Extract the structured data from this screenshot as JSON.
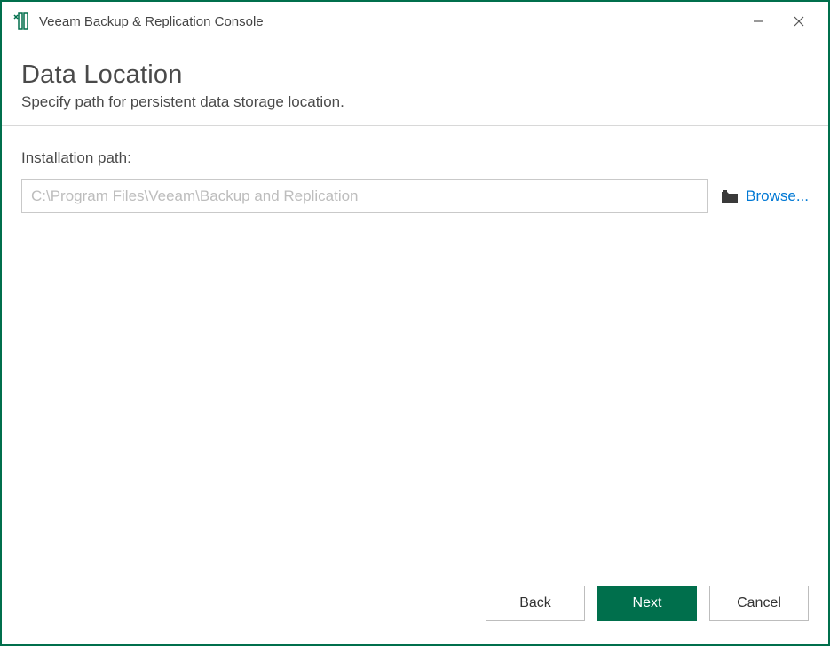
{
  "window": {
    "title": "Veeam Backup & Replication Console"
  },
  "header": {
    "title": "Data Location",
    "subtitle": "Specify path for persistent data storage location."
  },
  "form": {
    "path_label": "Installation path:",
    "path_value": "",
    "path_placeholder": "C:\\Program Files\\Veeam\\Backup and Replication",
    "browse_label": "Browse..."
  },
  "footer": {
    "back_label": "Back",
    "next_label": "Next",
    "cancel_label": "Cancel"
  },
  "colors": {
    "accent": "#006f4c",
    "link": "#0078d4"
  }
}
